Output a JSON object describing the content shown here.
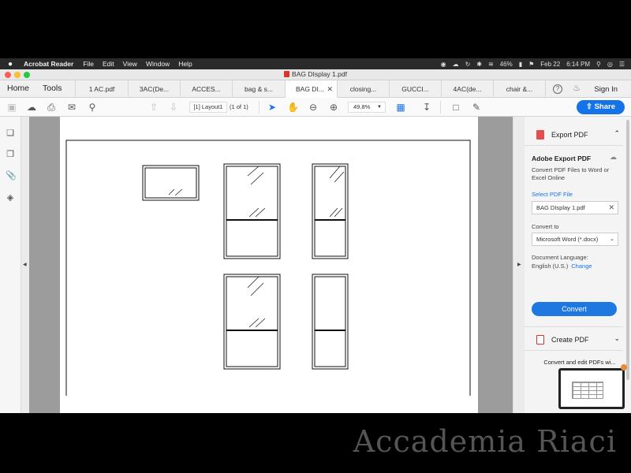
{
  "menubar": {
    "app": "Acrobat Reader",
    "items": [
      "File",
      "Edit",
      "View",
      "Window",
      "Help"
    ],
    "battery": "46%",
    "date": "Feb 22",
    "time": "6:14 PM"
  },
  "window": {
    "title": "BAG DIsplay 1.pdf"
  },
  "tabs": {
    "home": "Home",
    "tools": "Tools",
    "docs": [
      "1 AC.pdf",
      "3AC(De...",
      "ACCES...",
      "bag & s...",
      "BAG DI...",
      "closing...",
      "GUCCI...",
      "4AC(de...",
      "chair &..."
    ],
    "active_index": 4,
    "sign_in": "Sign In",
    "help_icon": "?"
  },
  "toolbar": {
    "page_label": "[1] Layout1",
    "page_of": "(1 of 1)",
    "zoom": "49.8%",
    "share": "Share"
  },
  "panel": {
    "export_header": "Export PDF",
    "title": "Adobe Export PDF",
    "description": "Convert PDF Files to Word or Excel Online",
    "select_label": "Select PDF File",
    "file_name": "BAG DIsplay 1.pdf",
    "convert_to_label": "Convert to",
    "format": "Microsoft Word (*.docx)",
    "doc_lang_label": "Document Language:",
    "doc_lang": "English (U.S.)",
    "change": "Change",
    "convert_button": "Convert",
    "create_header": "Create PDF",
    "promo": "Convert and edit PDFs wi..."
  },
  "colors": {
    "accent": "#1473e6",
    "pdf_red": "#d8342c"
  },
  "watermark": "Accademia Riaci"
}
